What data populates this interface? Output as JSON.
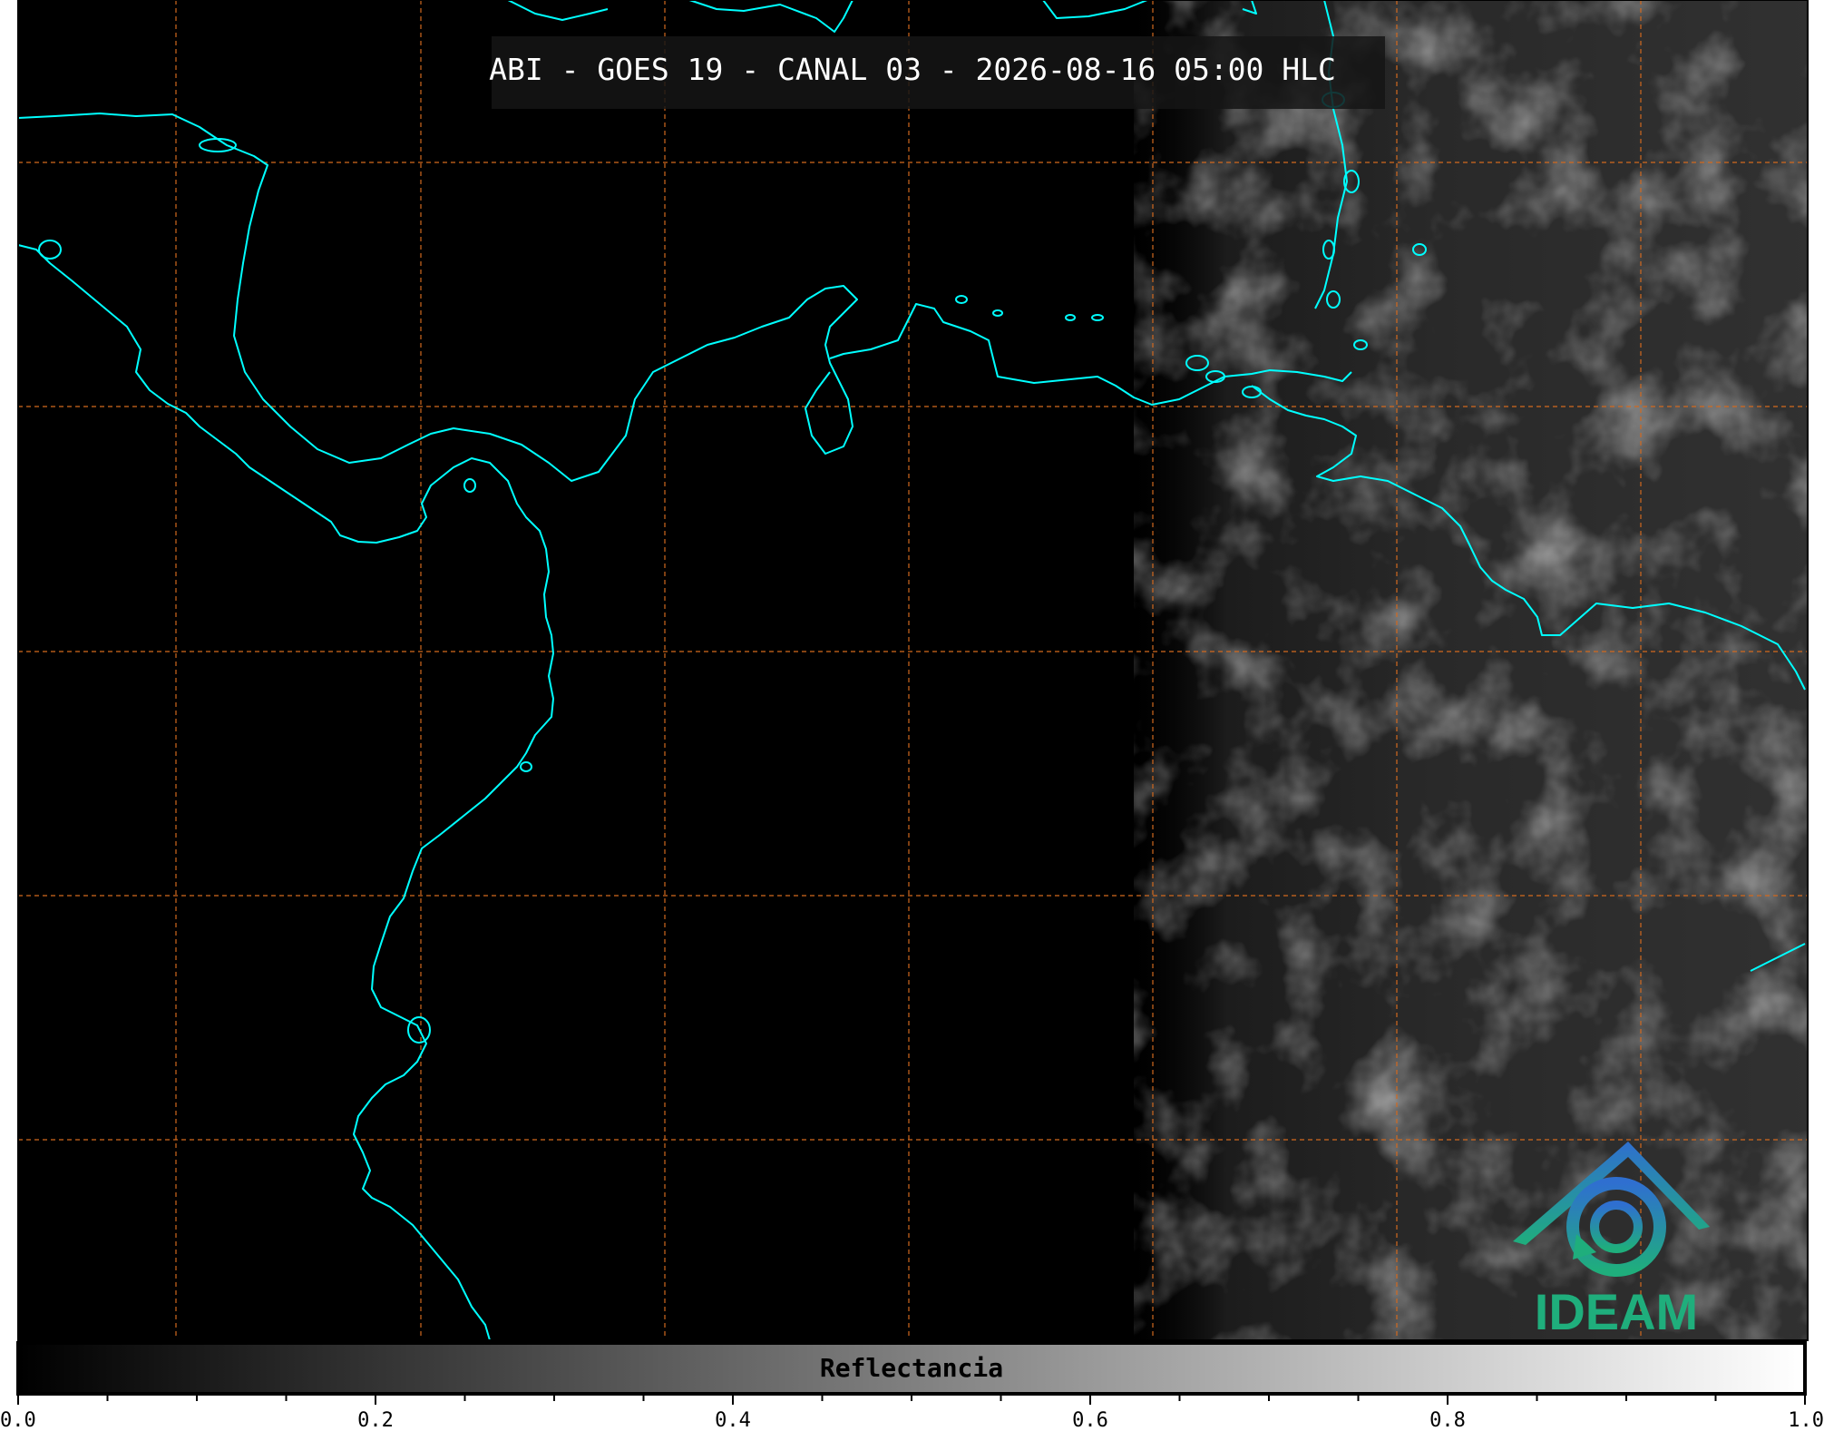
{
  "title": "ABI - GOES 19 - CANAL 03 - 2026-08-16 05:00 HLC",
  "colorbar": {
    "label": "Reflectancia",
    "range": [
      0.0,
      1.0
    ],
    "tick_labels": [
      "0.0",
      "0.2",
      "0.4",
      "0.6",
      "0.8",
      "1.0"
    ],
    "minor_tick_step": 0.05,
    "gradient_colors": [
      "#000000",
      "#ffffff"
    ]
  },
  "logo": {
    "text": "IDEAM",
    "colors": {
      "top": "#2f7fd0",
      "bottom": "#1fae7c"
    }
  },
  "colors": {
    "background": "#000000",
    "coastline": "#00ffff",
    "gridline": "#d2691e"
  },
  "icons": [
    "ideam-logo-icon"
  ]
}
